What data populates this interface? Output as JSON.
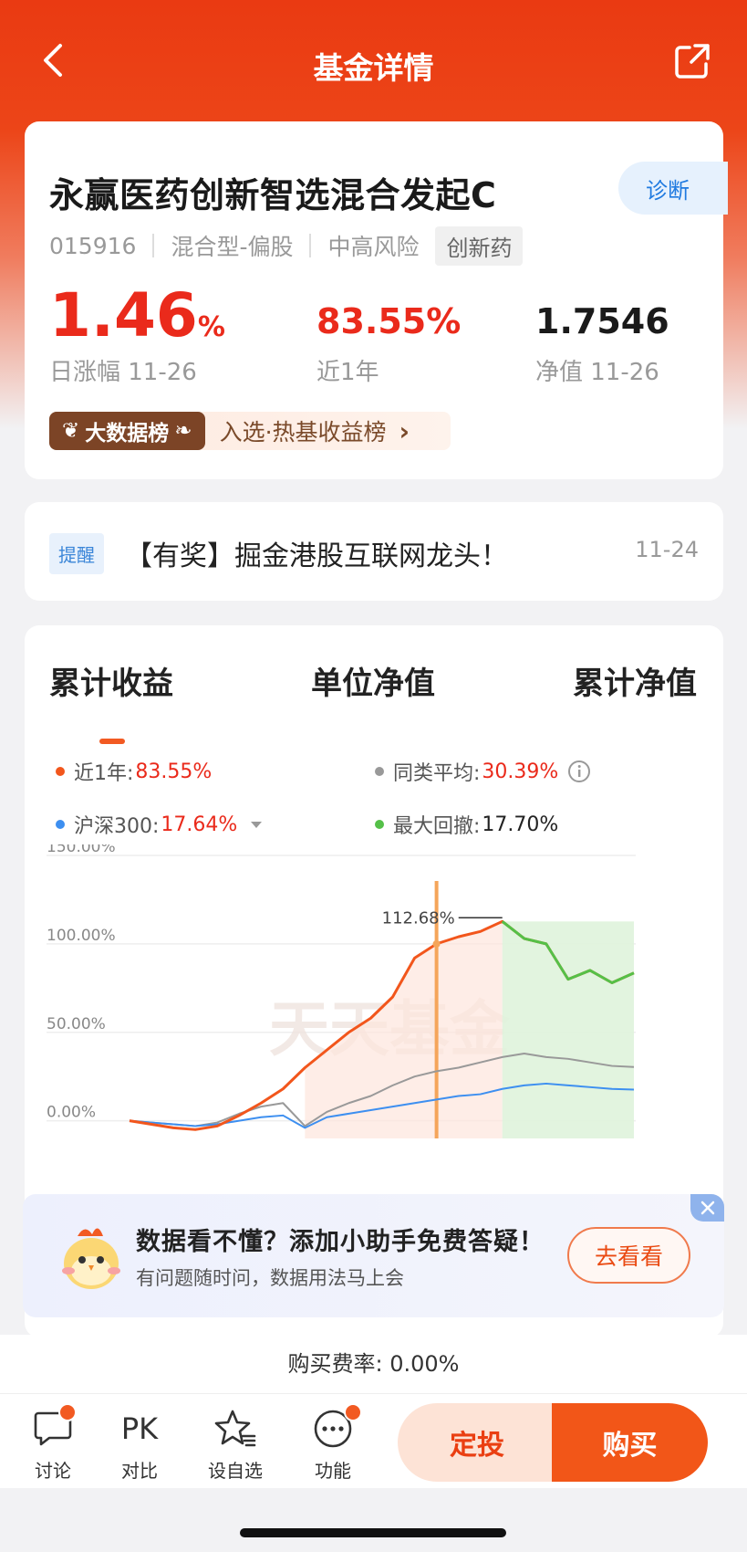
{
  "nav": {
    "title": "基金详情",
    "back_icon": "chevron-left-icon",
    "share_icon": "share-icon"
  },
  "fund": {
    "name": "永赢医药创新智选混合发起C",
    "code": "015916",
    "type": "混合型-偏股",
    "risk": "中高风险",
    "theme_tag": "创新药",
    "diagnose_label": "诊断",
    "daily_change_value": "1.46",
    "daily_change_unit": "%",
    "daily_change_label": "日涨幅 11-26",
    "year_return": "83.55%",
    "year_return_label": "近1年",
    "nav_value": "1.7546",
    "nav_label": "净值 11-26",
    "rank_badge": "大数据榜",
    "rank_text": "入选·热基收益榜"
  },
  "notice": {
    "tag": "提醒",
    "text": "【有奖】掘金港股互联网龙头！",
    "date": "11-24"
  },
  "chart_tabs": [
    "累计收益",
    "单位净值",
    "累计净值"
  ],
  "legend": {
    "fund_label": "近1年:",
    "fund_value": "83.55%",
    "peer_label": "同类平均:",
    "peer_value": "30.39%",
    "index_label": "沪深300:",
    "index_value": "17.64%",
    "drawdown_label": "最大回撤:",
    "drawdown_value": "17.70%",
    "colors": {
      "fund": "#f2561c",
      "peer": "#999999",
      "index": "#3d8ff0",
      "drawdown": "#55c048"
    }
  },
  "chart_data": {
    "type": "line",
    "y_ticks": [
      "150.00%",
      "100.00%",
      "50.00%",
      "0.00%"
    ],
    "ylim": [
      -10,
      150
    ],
    "peak_label": "112.68%",
    "watermark": "天天基金",
    "series": [
      {
        "name": "近1年",
        "values": [
          0,
          -2,
          -4,
          -5,
          -3,
          3,
          10,
          18,
          30,
          40,
          50,
          58,
          70,
          92,
          100,
          104,
          107,
          112.68,
          103,
          100,
          80,
          85,
          78,
          83.55
        ]
      },
      {
        "name": "同类平均",
        "values": [
          0,
          -1,
          -2,
          -3,
          -1,
          4,
          8,
          10,
          -3,
          5,
          10,
          14,
          20,
          25,
          28,
          30,
          33,
          36,
          38,
          36,
          35,
          33,
          31,
          30.39
        ]
      },
      {
        "name": "沪深300",
        "values": [
          0,
          -1,
          -2,
          -3,
          -2,
          0,
          2,
          3,
          -4,
          2,
          4,
          6,
          8,
          10,
          12,
          14,
          15,
          18,
          20,
          21,
          20,
          19,
          18,
          17.64
        ]
      }
    ]
  },
  "helper": {
    "title": "数据看不懂？添加小助手免费答疑！",
    "subtitle": "有问题随时问，数据用法马上会",
    "button": "去看看"
  },
  "fee": "购买费率: 0.00%",
  "bottom_bar": {
    "discuss": "讨论",
    "compare_icon_text": "PK",
    "compare": "对比",
    "watchlist": "设自选",
    "functions": "功能",
    "plan": "定投",
    "buy": "购买"
  }
}
